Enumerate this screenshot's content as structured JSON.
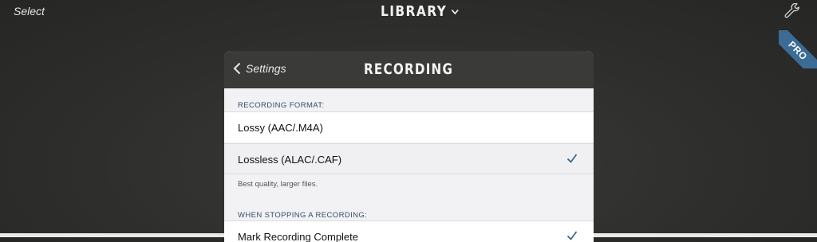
{
  "topbar": {
    "select_label": "Select",
    "title": "LIBRARY",
    "wrench_icon": "wrench-icon",
    "pro_badge": "PRO"
  },
  "panel": {
    "back_label": "Settings",
    "title": "RECORDING",
    "recording_format": {
      "header": "RECORDING FORMAT:",
      "options": [
        {
          "label": "Lossy (AAC/.M4A)",
          "selected": false
        },
        {
          "label": "Lossless (ALAC/.CAF)",
          "selected": true
        }
      ],
      "footnote": "Best quality, larger files."
    },
    "stopping": {
      "header": "WHEN STOPPING A RECORDING:",
      "options": [
        {
          "label": "Mark Recording Complete",
          "selected": true
        }
      ]
    }
  },
  "colors": {
    "background": "#2e2e2c",
    "header": "#3a3a38",
    "accent": "#2f5f86",
    "ribbon": "#3c6b96"
  }
}
